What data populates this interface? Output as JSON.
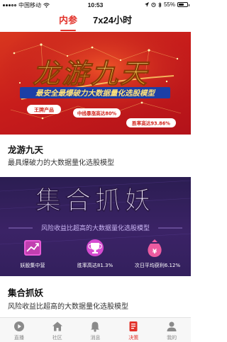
{
  "status_bar": {
    "carrier": "中国移动",
    "time": "10:53",
    "battery": "55%",
    "battery_level": 0.55
  },
  "tabs": [
    {
      "label": "内参",
      "active": true
    },
    {
      "label": "7x24小时",
      "active": false
    }
  ],
  "cards": [
    {
      "banner": {
        "headline": "龙游九天",
        "tagline": "最安全最爆破力大数据量化选股模型",
        "badge": "王牌产品",
        "stat_1": "中线暴涨高达80%",
        "stat_2": "胜率高达93.86%"
      },
      "title": "龙游九天",
      "subtitle": "最具爆破力的大数据量化选股模型"
    },
    {
      "banner": {
        "headline": "集合抓妖",
        "tagline": "风险收益比超高的大数据量化选股模型",
        "features": [
          {
            "icon": "trend-chart-icon",
            "label": "妖股集中营"
          },
          {
            "icon": "trophy-icon",
            "label": "胜率高达81.3%"
          },
          {
            "icon": "money-bag-icon",
            "label": "次日平均获利6.12%"
          }
        ]
      },
      "title": "集合抓妖",
      "subtitle": "风险收益比超高的大数据量化选股模型"
    }
  ],
  "bottom_nav": [
    {
      "label": "直播",
      "icon": "play-circle-icon",
      "active": false
    },
    {
      "label": "社区",
      "icon": "home-icon",
      "active": false
    },
    {
      "label": "消息",
      "icon": "bell-icon",
      "active": false
    },
    {
      "label": "决策",
      "icon": "decision-doc-icon",
      "active": true
    },
    {
      "label": "我的",
      "icon": "person-icon",
      "active": false
    }
  ],
  "colors": {
    "accent": "#e2322a",
    "banner1_red": "#c81d1b",
    "banner2_purple": "#3b2366",
    "gold": "#f7d24a",
    "nav_inactive": "#888888"
  }
}
